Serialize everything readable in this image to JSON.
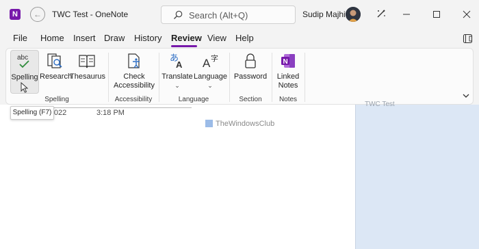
{
  "window": {
    "title": "TWC Test - OneNote",
    "app_icon_letter": "N",
    "back_icon": "back-arrow-icon"
  },
  "search": {
    "placeholder": "Search (Alt+Q)",
    "icon": "search-icon"
  },
  "user": {
    "name": "Sudip Majhi"
  },
  "menu": {
    "items": [
      "File",
      "Home",
      "Insert",
      "Draw",
      "History",
      "Review",
      "View",
      "Help"
    ],
    "active": "Review"
  },
  "ribbon": {
    "groups": [
      {
        "label": "Spelling",
        "buttons": [
          {
            "label": "Spelling",
            "icon": "abc-check-icon",
            "icon_text": "abc"
          },
          {
            "label": "Research",
            "icon": "research-icon"
          },
          {
            "label": "Thesaurus",
            "icon": "thesaurus-icon"
          }
        ]
      },
      {
        "label": "Accessibility",
        "buttons": [
          {
            "label": "Check Accessibility",
            "line1": "Check",
            "line2": "Accessibility",
            "icon": "accessibility-check-icon"
          }
        ]
      },
      {
        "label": "Language",
        "buttons": [
          {
            "label": "Translate",
            "icon": "translate-icon",
            "has_dropdown": true,
            "caret": "⌄"
          },
          {
            "label": "Language",
            "icon": "language-icon",
            "has_dropdown": true,
            "caret": "⌄"
          }
        ]
      },
      {
        "label": "Section",
        "buttons": [
          {
            "label": "Password",
            "icon": "lock-icon"
          }
        ]
      },
      {
        "label": "Notes",
        "buttons": [
          {
            "label": "Linked Notes",
            "line1": "Linked",
            "line2": "Notes",
            "icon": "linked-notes-icon"
          }
        ]
      }
    ],
    "collapse_icon": "chevron-down-icon"
  },
  "tooltip": {
    "text": "Spelling (F7)"
  },
  "page": {
    "date": "y, 2022",
    "time": "3:18 PM",
    "watermark": "TheWindowsClub"
  },
  "side_pane": {
    "page_title": "TWC Test"
  },
  "colors": {
    "accent": "#7719aa",
    "side_pane": "#dce7f5"
  }
}
